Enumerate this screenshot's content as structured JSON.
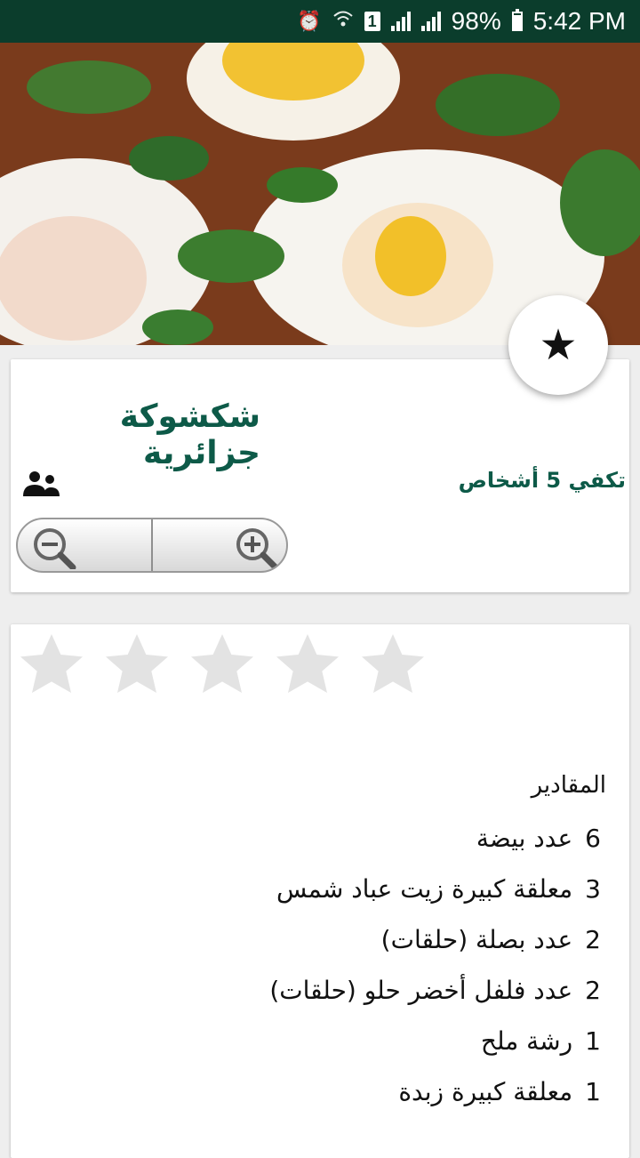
{
  "status_bar": {
    "battery_percent": "98%",
    "time": "5:42 PM",
    "sim_slot": "1",
    "icons": [
      "alarm-icon",
      "wifi-icon",
      "sim-icon",
      "signal-icon",
      "signal-icon",
      "battery-icon"
    ]
  },
  "hero": {
    "image": "shakshuka-photo"
  },
  "fab": {
    "icon": "star-icon"
  },
  "recipe": {
    "title": "شكشوكة جزائرية",
    "servings_text": "تكفي 5 أشخاص",
    "people_icon": "people-icon",
    "zoom_out_icon": "zoom-out-icon",
    "zoom_in_icon": "zoom-in-icon"
  },
  "rating": {
    "value": 0,
    "max": 5
  },
  "ingredients": {
    "heading": "المقادير",
    "items": [
      {
        "qty": "6",
        "text": "عدد بيضة"
      },
      {
        "qty": "3",
        "text": "معلقة كبيرة زيت عباد شمس"
      },
      {
        "qty": "2",
        "text": "عدد بصلة (حلقات)"
      },
      {
        "qty": "2",
        "text": "عدد فلفل أخضر حلو (حلقات)"
      },
      {
        "qty": "1",
        "text": "رشة ملح"
      },
      {
        "qty": "1",
        "text": "معلقة كبيرة زبدة"
      }
    ]
  },
  "colors": {
    "status_bar": "#0b3d2c",
    "accent_text": "#0d5a48",
    "empty_star": "#e3e3e3"
  }
}
